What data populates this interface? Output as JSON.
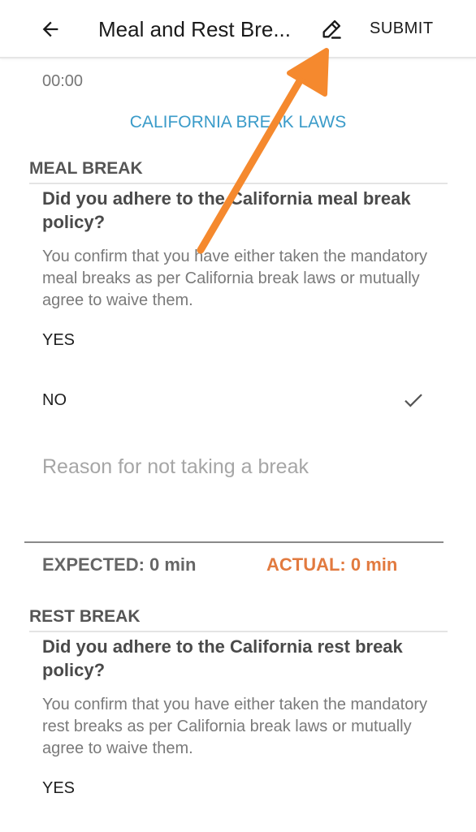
{
  "header": {
    "title": "Meal and Rest Bre...",
    "submit_label": "SUBMIT"
  },
  "time_value": "00:00",
  "law_link": "CALIFORNIA BREAK LAWS",
  "meal": {
    "section_label": "MEAL BREAK",
    "question": "Did you adhere to the California meal break policy?",
    "description": "You confirm that you have either taken the mandatory meal breaks as per California break laws or mutually agree to waive them.",
    "option_yes": "YES",
    "option_no": "NO",
    "reason_placeholder": "Reason for not taking a break",
    "expected": "EXPECTED: 0 min",
    "actual": "ACTUAL: 0 min"
  },
  "rest": {
    "section_label": "REST BREAK",
    "question": "Did you adhere to the California rest break policy?",
    "description": "You confirm that you have either taken the mandatory rest breaks as per California break laws or mutually agree to waive them.",
    "option_yes": "YES"
  },
  "icons": {
    "back": "arrow-left-icon",
    "edit": "pencil-icon",
    "check": "checkmark-icon",
    "annotation": "orange-arrow-icon"
  },
  "colors": {
    "link": "#3a9bc9",
    "actual": "#e27a3f",
    "annotation_arrow": "#f5892e"
  }
}
